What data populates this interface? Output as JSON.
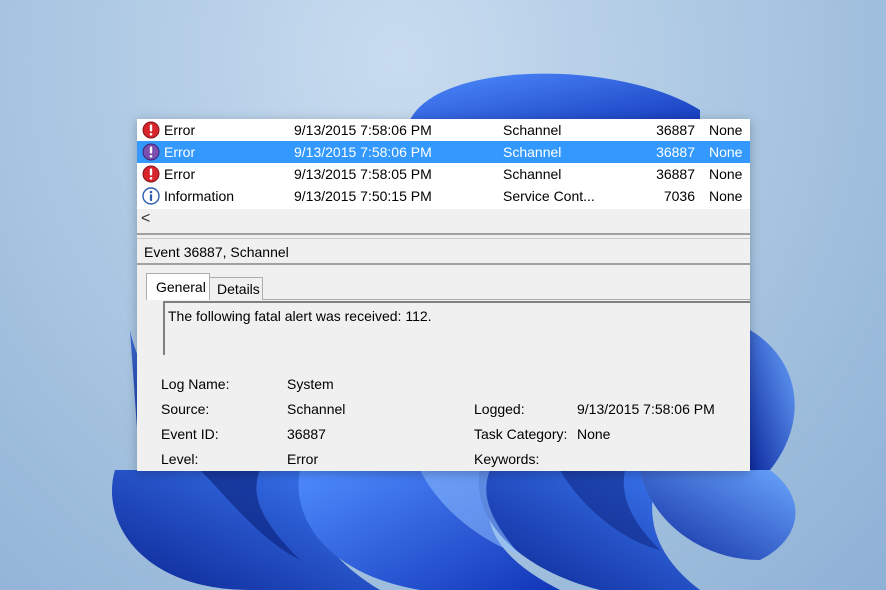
{
  "event_list": {
    "rows": [
      {
        "level": "Error",
        "date": "9/13/2015 7:58:06 PM",
        "source": "Schannel",
        "event_id": "36887",
        "task": "None",
        "icon": "error-icon"
      },
      {
        "level": "Error",
        "date": "9/13/2015 7:58:06 PM",
        "source": "Schannel",
        "event_id": "36887",
        "task": "None",
        "icon": "error-icon"
      },
      {
        "level": "Error",
        "date": "9/13/2015 7:58:05 PM",
        "source": "Schannel",
        "event_id": "36887",
        "task": "None",
        "icon": "error-icon"
      },
      {
        "level": "Information",
        "date": "9/13/2015 7:50:15 PM",
        "source": "Service Cont...",
        "event_id": "7036",
        "task": "None",
        "icon": "info-icon"
      }
    ],
    "selected_index": 1,
    "scroll_left_glyph": "<"
  },
  "detail": {
    "title": "Event 36887, Schannel",
    "tabs": [
      {
        "label": "General",
        "active": true
      },
      {
        "label": "Details",
        "active": false
      }
    ],
    "message": "The following fatal alert was received: 112.",
    "fields": {
      "log_name_label": "Log Name:",
      "log_name_value": "System",
      "source_label": "Source:",
      "source_value": "Schannel",
      "logged_label": "Logged:",
      "logged_value": "9/13/2015 7:58:06 PM",
      "event_id_label": "Event ID:",
      "event_id_value": "36887",
      "task_category_label": "Task Category:",
      "task_category_value": "None",
      "level_label": "Level:",
      "level_value": "Error",
      "keywords_label": "Keywords:"
    }
  },
  "colors": {
    "selection": "#3399ff",
    "error_red": "#d6262c",
    "info_blue": "#2a5fb0",
    "wallpaper_blue": "#1f4fe0"
  }
}
